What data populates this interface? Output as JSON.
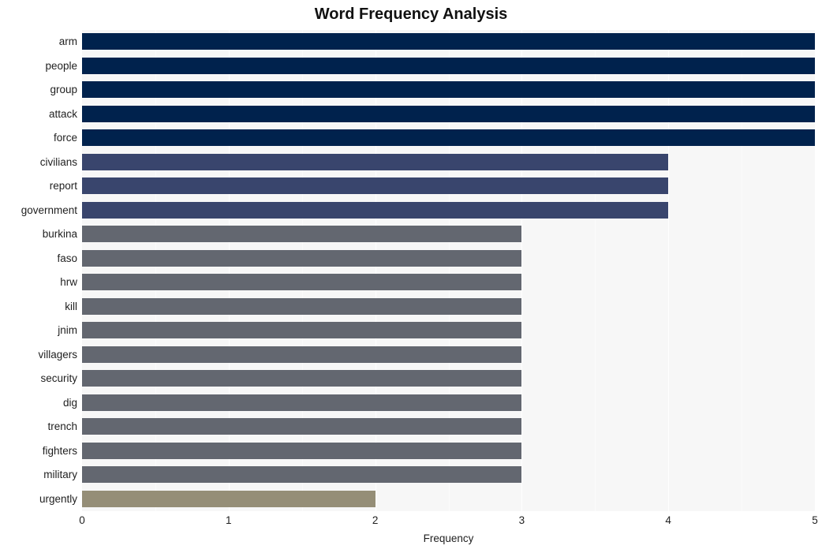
{
  "chart_data": {
    "type": "bar",
    "orientation": "horizontal",
    "title": "Word Frequency Analysis",
    "xlabel": "Frequency",
    "ylabel": "",
    "xlim": [
      0,
      5
    ],
    "xticks": [
      0,
      1,
      2,
      3,
      4,
      5
    ],
    "xtick_labels": [
      "0",
      "1",
      "2",
      "3",
      "4",
      "5"
    ],
    "grid": true,
    "grid_axis": "x",
    "legend": false,
    "categories": [
      "arm",
      "people",
      "group",
      "attack",
      "force",
      "civilians",
      "report",
      "government",
      "burkina",
      "faso",
      "hrw",
      "kill",
      "jnim",
      "villagers",
      "security",
      "dig",
      "trench",
      "fighters",
      "military",
      "urgently"
    ],
    "values": [
      5,
      5,
      5,
      5,
      5,
      4,
      4,
      4,
      3,
      3,
      3,
      3,
      3,
      3,
      3,
      3,
      3,
      3,
      3,
      2
    ],
    "bar_colors": [
      "#00224d",
      "#00224d",
      "#00224d",
      "#00224d",
      "#00224d",
      "#39456d",
      "#39456d",
      "#39456d",
      "#636770",
      "#636770",
      "#636770",
      "#636770",
      "#636770",
      "#636770",
      "#636770",
      "#636770",
      "#636770",
      "#636770",
      "#636770",
      "#958e77"
    ],
    "panel_background": "#f7f7f7",
    "gridline_color": "#ffffff"
  },
  "colors": {
    "value_5": "#00224d",
    "value_4": "#39456d",
    "value_3": "#636770",
    "value_2": "#958e77",
    "panel": "#f7f7f7",
    "grid": "#ffffff",
    "text": "#1f1f1f"
  }
}
